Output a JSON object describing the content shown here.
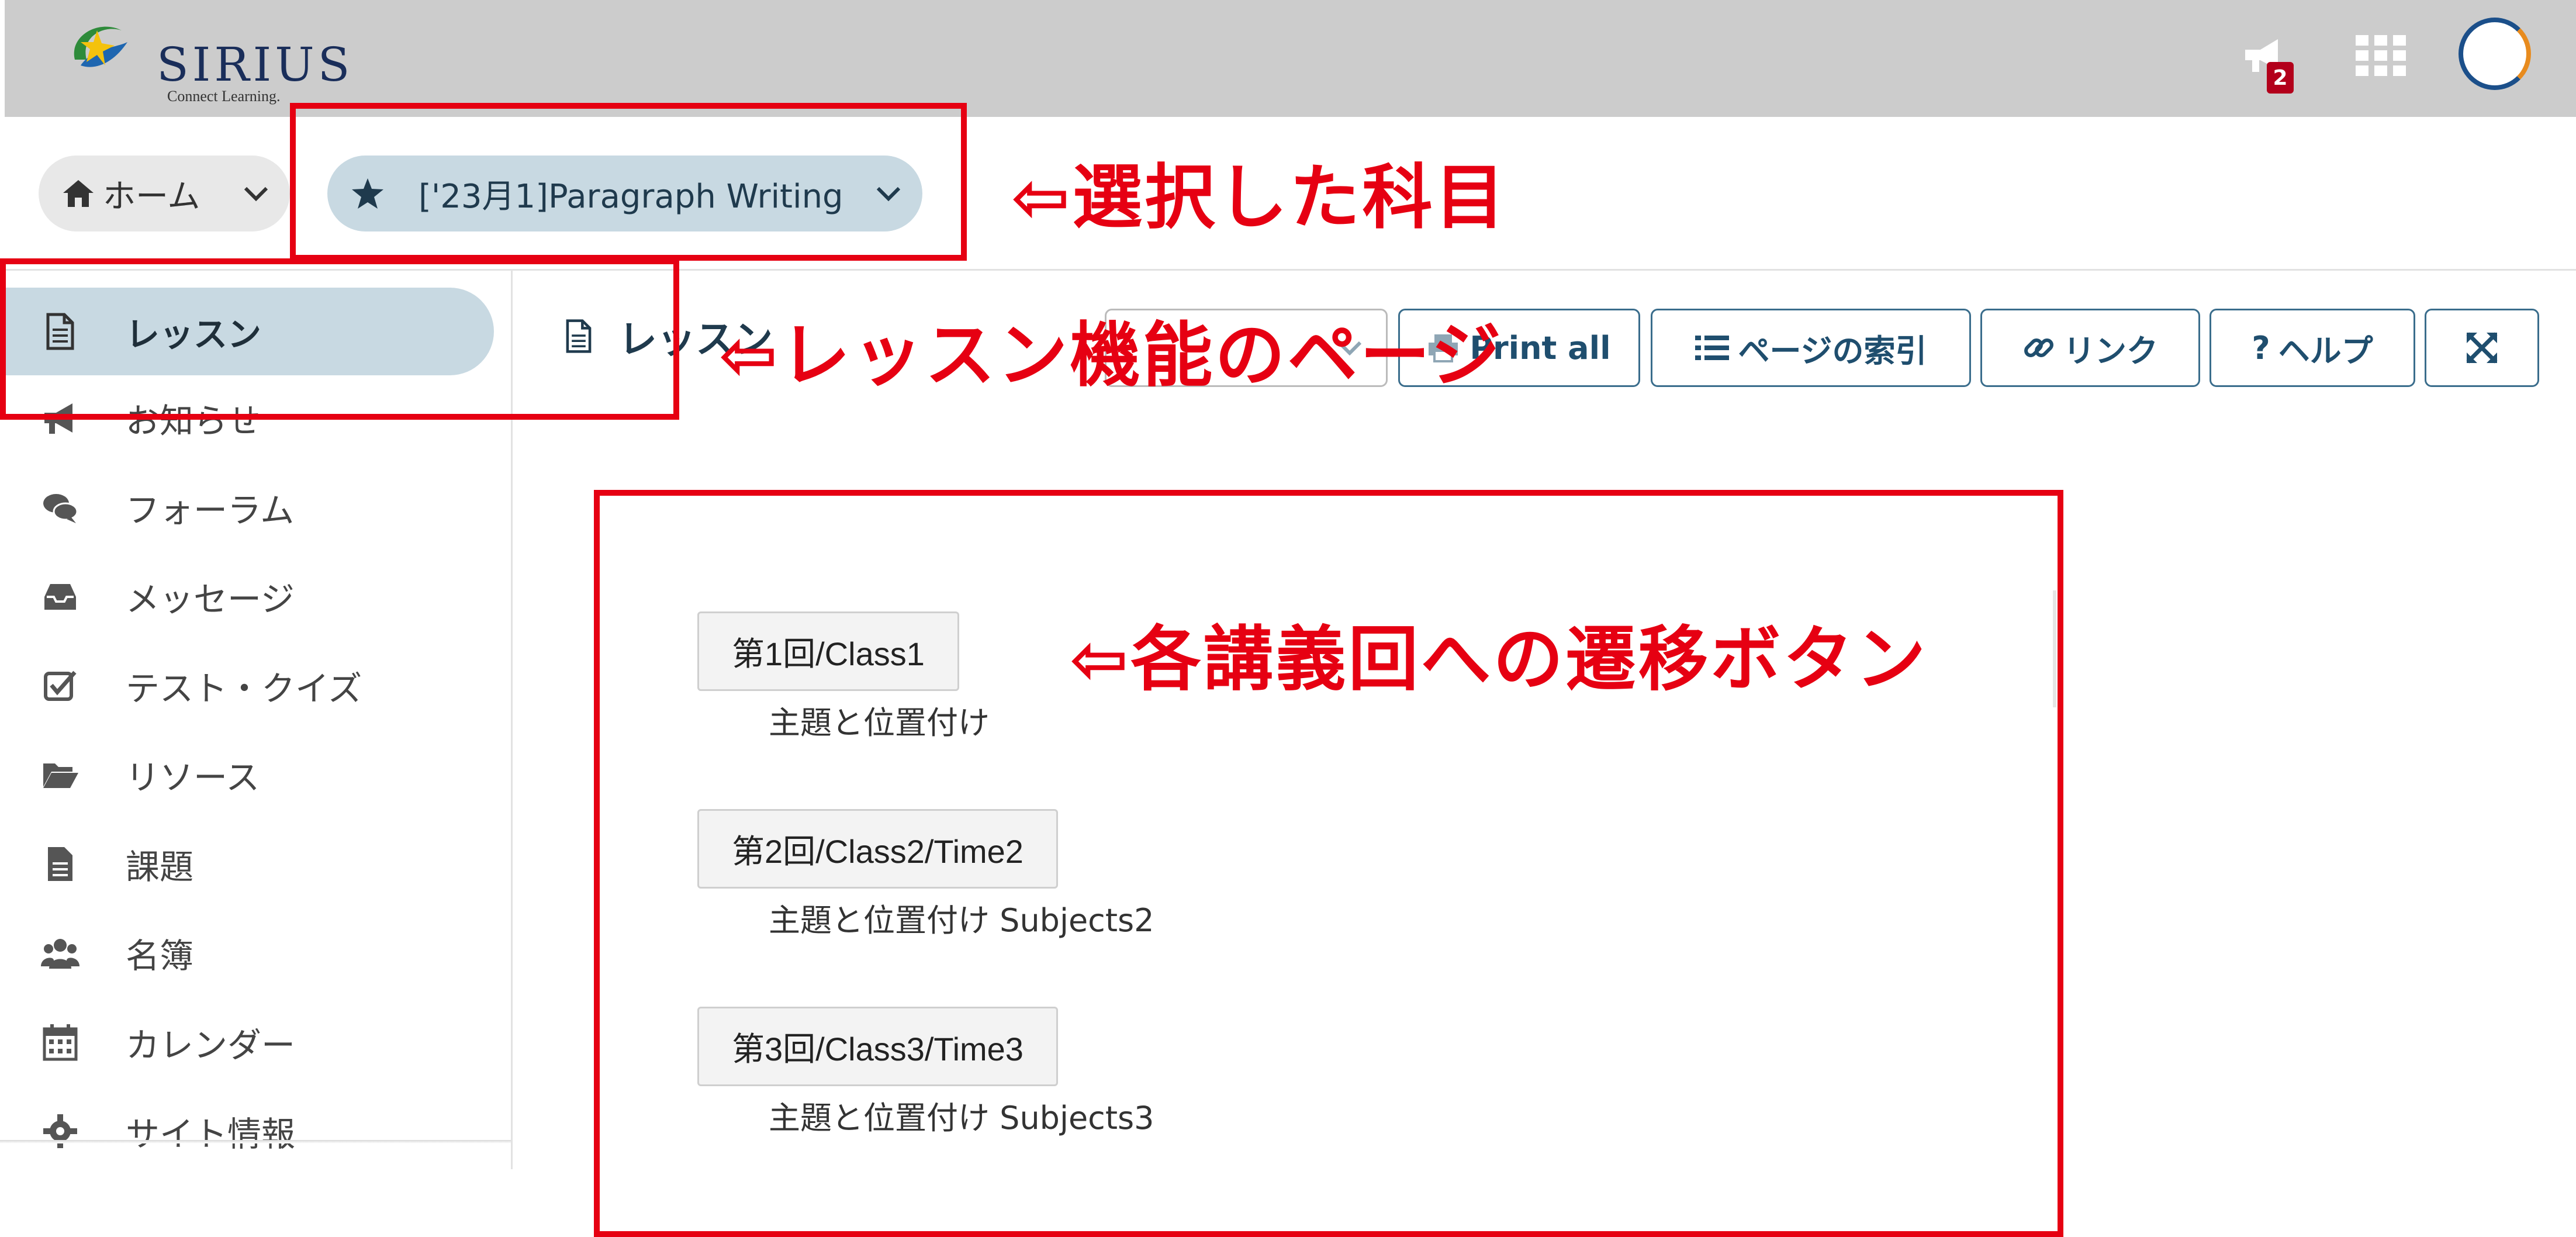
{
  "header": {
    "logo_text": "SIRIUS",
    "logo_subtitle": "Connect Learning.",
    "notification_count": "2"
  },
  "breadcrumb": {
    "home_label": "ホーム",
    "site_label": "['23月1]Paragraph Writing"
  },
  "sidebar": {
    "items": [
      {
        "label": "レッスン",
        "icon": "document-icon",
        "active": true
      },
      {
        "label": "お知らせ",
        "icon": "megaphone-icon"
      },
      {
        "label": "フォーラム",
        "icon": "comments-icon"
      },
      {
        "label": "メッセージ",
        "icon": "inbox-icon"
      },
      {
        "label": "テスト・クイズ",
        "icon": "checkbox-icon"
      },
      {
        "label": "リソース",
        "icon": "folder-open-icon"
      },
      {
        "label": "課題",
        "icon": "file-icon"
      },
      {
        "label": "名簿",
        "icon": "users-icon"
      },
      {
        "label": "カレンダー",
        "icon": "calendar-icon"
      },
      {
        "label": "サイト情報",
        "icon": "gear-icon"
      }
    ]
  },
  "main": {
    "page_title": "レッスン",
    "toolbar": {
      "print_label": "Print all",
      "index_label": "ページの索引",
      "link_label": "リンク",
      "help_label": "ヘルプ"
    },
    "lessons": [
      {
        "button": "第1回/Class1",
        "description": "主題と位置付け"
      },
      {
        "button": "第2回/Class2/Time2",
        "description": "主題と位置付け Subjects2"
      },
      {
        "button": "第3回/Class3/Time3",
        "description": "主題と位置付け Subjects3"
      }
    ]
  },
  "annotations": {
    "selected_subject": "⇦選択した科目",
    "lesson_page": "⇦レッスン機能のページ",
    "lesson_buttons": "⇦各講義回への遷移ボタン"
  },
  "colors": {
    "header_bg": "#cccccc",
    "active_bg": "#c8d9e2",
    "annotation_red": "#e60012",
    "accent": "#1f4e6e"
  }
}
